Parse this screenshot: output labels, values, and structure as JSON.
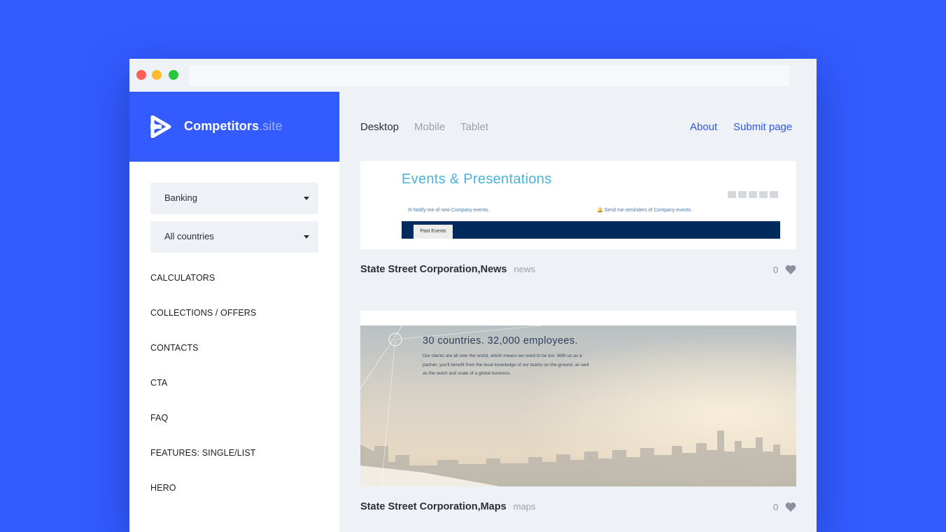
{
  "brand": {
    "name": "Competitors",
    "tld": ".site"
  },
  "filters": {
    "industry": "Banking",
    "country": "All countries"
  },
  "categories": [
    "CALCULATORS",
    "COLLECTIONS / OFFERS",
    "CONTACTS",
    "CTA",
    "FAQ",
    "FEATURES: SINGLE/LIST",
    "HERO"
  ],
  "device_tabs": [
    "Desktop",
    "Mobile",
    "Tablet"
  ],
  "nav_links": {
    "about": "About",
    "submit": "Submit page"
  },
  "cards": [
    {
      "title": "State Street Corporation,News",
      "tag": "news",
      "likes": "0",
      "preview": {
        "heading": "Events & Presentations",
        "notify": "Notify me of new Company events.",
        "remind": "Send me reminders of Company events.",
        "tab": "Past Events"
      }
    },
    {
      "title": "State Street Corporation,Maps",
      "tag": "maps",
      "likes": "0",
      "preview": {
        "heading": "30 countries. 32,000 employees.",
        "body": "Our clients are all over the world, which means we need to be too. With us as a partner, you'll benefit from the local knowledge of our teams on-the-ground, as well as the reach and scale of a global business."
      }
    }
  ],
  "colors": {
    "background": "#335bff",
    "accent": "#335bff",
    "link": "#2f55e8",
    "navy": "#002b5c"
  },
  "icons": {
    "logo": "play-arrow-icon",
    "like": "heart-icon",
    "dropdown": "caret-down-icon"
  }
}
